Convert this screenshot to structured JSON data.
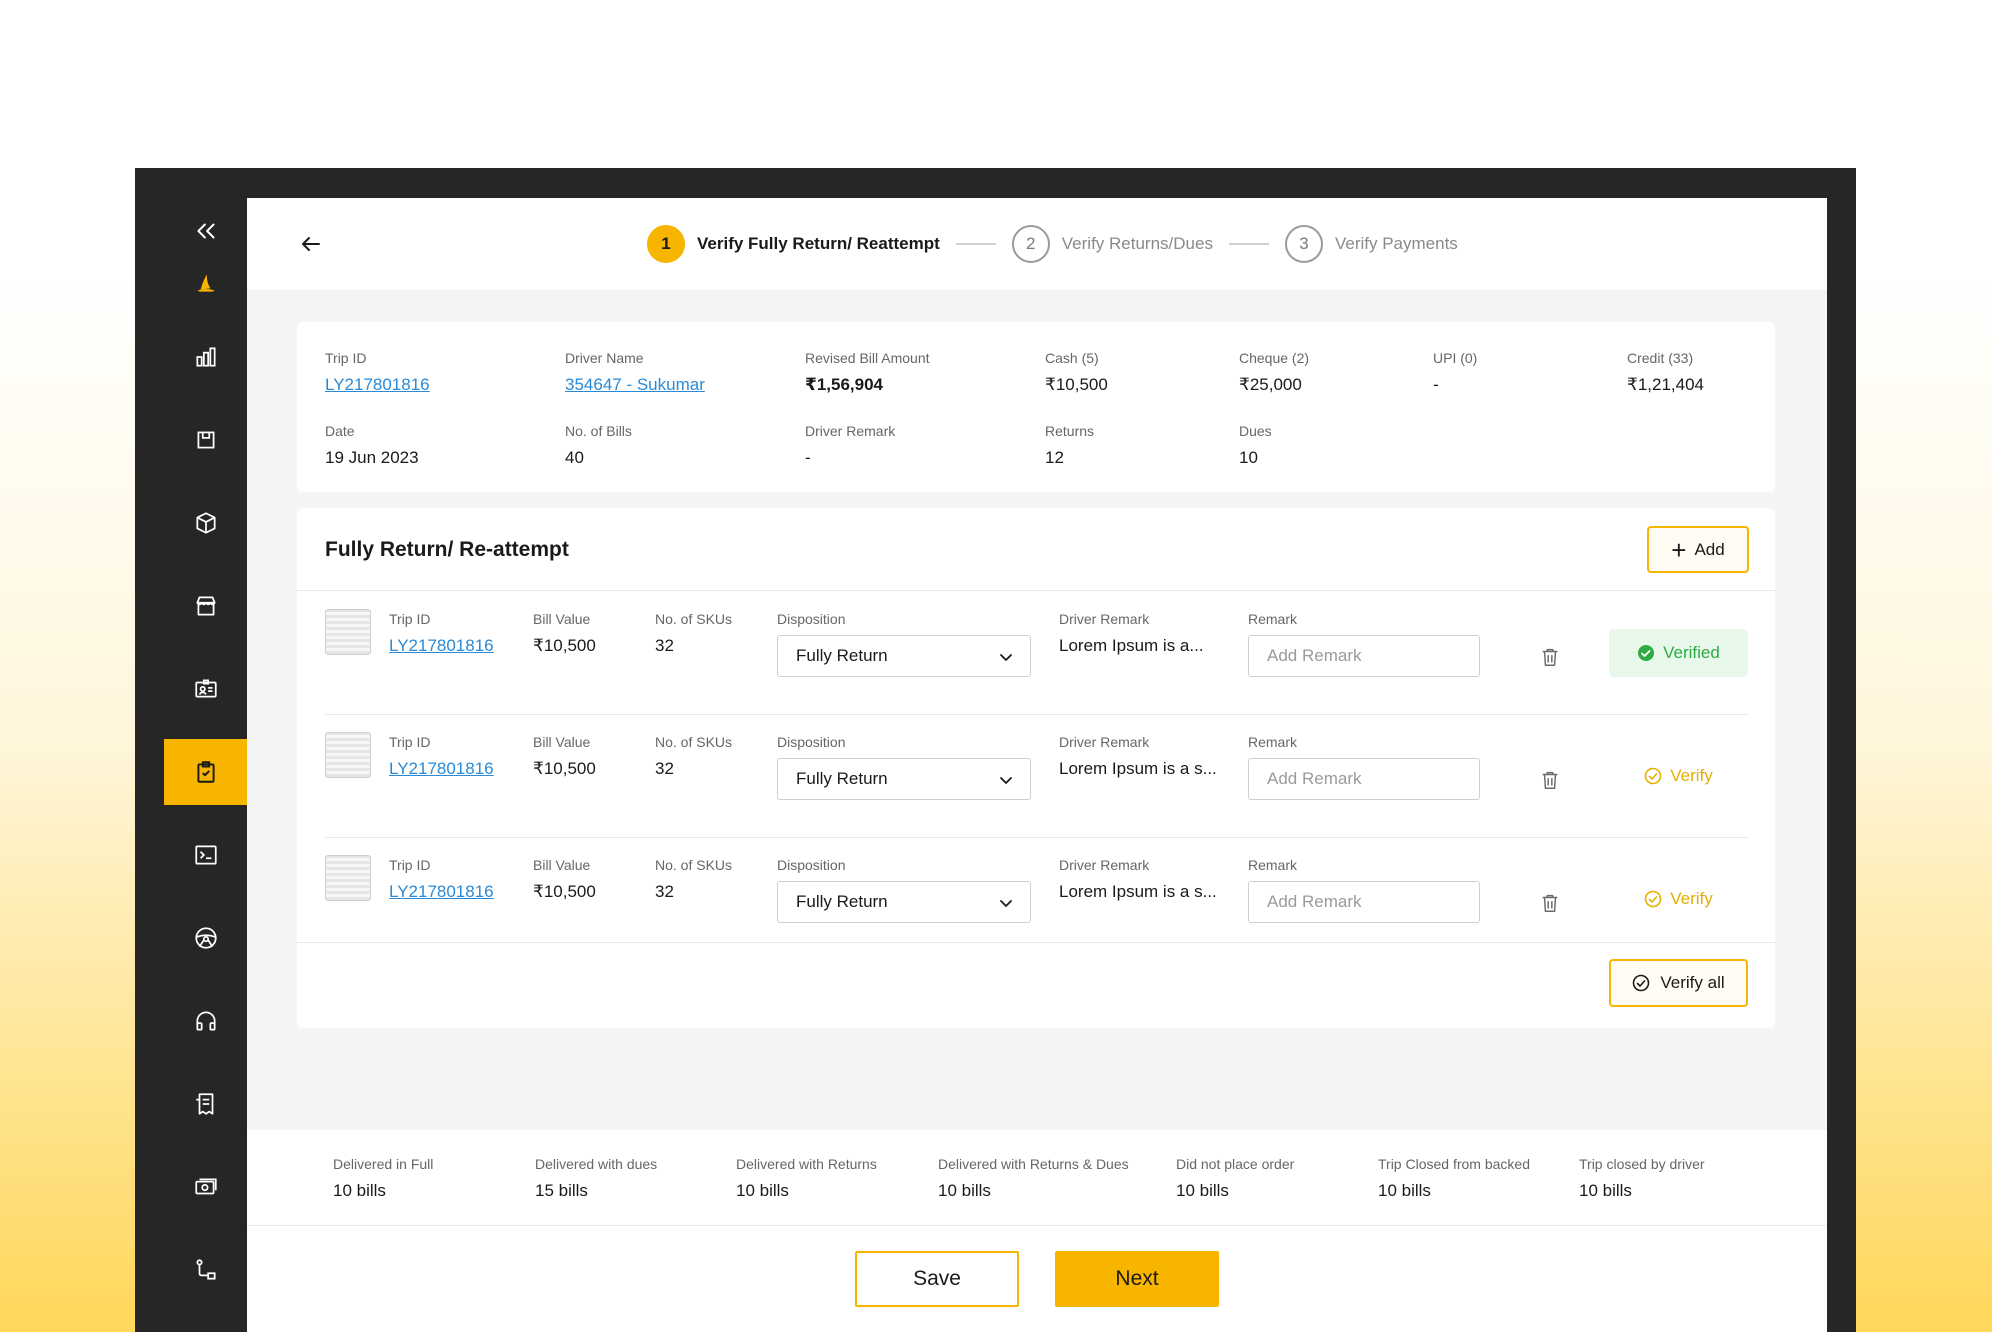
{
  "stepper": {
    "steps": [
      {
        "num": "1",
        "label": "Verify Fully Return/ Reattempt"
      },
      {
        "num": "2",
        "label": "Verify Returns/Dues"
      },
      {
        "num": "3",
        "label": "Verify Payments"
      }
    ],
    "active_step": 1
  },
  "trip_info": {
    "trip_id": {
      "label": "Trip ID",
      "value": "LY217801816"
    },
    "driver_name": {
      "label": "Driver Name",
      "value": "354647 - Sukumar"
    },
    "revised_bill": {
      "label": "Revised Bill Amount",
      "value": "₹1,56,904"
    },
    "cash": {
      "label": "Cash (5)",
      "value": "₹10,500"
    },
    "cheque": {
      "label": "Cheque (2)",
      "value": "₹25,000"
    },
    "upi": {
      "label": "UPI (0)",
      "value": "-"
    },
    "credit": {
      "label": "Credit (33)",
      "value": "₹1,21,404"
    },
    "date": {
      "label": "Date",
      "value": "19 Jun 2023"
    },
    "no_of_bills": {
      "label": "No. of Bills",
      "value": "40"
    },
    "driver_remark": {
      "label": "Driver Remark",
      "value": "-"
    },
    "returns": {
      "label": "Returns",
      "value": "12"
    },
    "dues": {
      "label": "Dues",
      "value": "10"
    }
  },
  "list": {
    "title": "Fully Return/ Re-attempt",
    "add_label": "Add",
    "col_labels": {
      "trip_id": "Trip ID",
      "bill_value": "Bill Value",
      "skus": "No. of SKUs",
      "disposition": "Disposition",
      "driver_remark": "Driver Remark",
      "remark": "Remark"
    },
    "remark_placeholder": "Add Remark",
    "rows": [
      {
        "trip_id": "LY217801816",
        "bill_value": "₹10,500",
        "skus": "32",
        "disposition": "Fully Return",
        "driver_remark": "Lorem Ipsum is a...",
        "status": "Verified"
      },
      {
        "trip_id": "LY217801816",
        "bill_value": "₹10,500",
        "skus": "32",
        "disposition": "Fully Return",
        "driver_remark": "Lorem Ipsum is a s...",
        "status": "Verify"
      },
      {
        "trip_id": "LY217801816",
        "bill_value": "₹10,500",
        "skus": "32",
        "disposition": "Fully Return",
        "driver_remark": "Lorem Ipsum is a s...",
        "status": "Verify"
      }
    ],
    "verify_all_label": "Verify all"
  },
  "summary": [
    {
      "label": "Delivered in Full",
      "value": "10 bills"
    },
    {
      "label": "Delivered with dues",
      "value": "15 bills"
    },
    {
      "label": "Delivered with Returns",
      "value": "10 bills"
    },
    {
      "label": "Delivered with Returns & Dues",
      "value": "10 bills"
    },
    {
      "label": "Did not place order",
      "value": "10 bills"
    },
    {
      "label": "Trip Closed from backed",
      "value": "10 bills"
    },
    {
      "label": "Trip closed by driver",
      "value": "10 bills"
    }
  ],
  "actions": {
    "save_label": "Save",
    "next_label": "Next"
  },
  "sidebar": {
    "icons": [
      "collapse-icon",
      "logo-icon",
      "analytics-icon",
      "save-icon",
      "package-icon",
      "store-icon",
      "id-card-icon",
      "clipboard-check-icon",
      "terminal-icon",
      "steering-wheel-icon",
      "headphones-icon",
      "receipt-icon",
      "cash-icon",
      "route-icon"
    ],
    "active": "clipboard-check-icon"
  },
  "colors": {
    "accent": "#f7b500",
    "link": "#2a8ad6",
    "verified": "#2eab45",
    "sidebar_bg": "#262626"
  }
}
